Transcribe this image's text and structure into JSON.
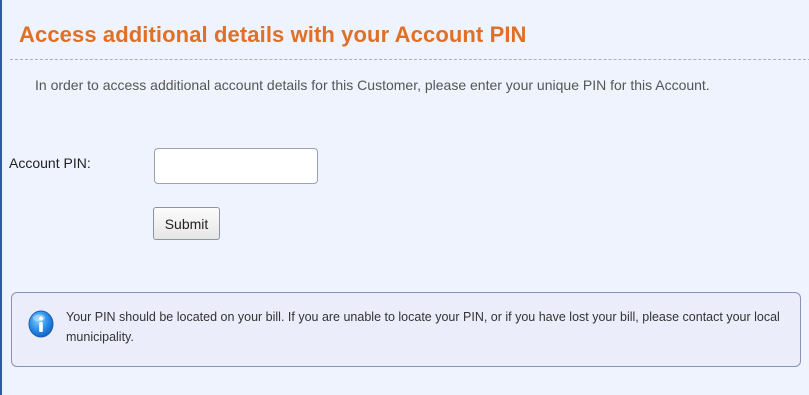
{
  "header": {
    "title": "Access additional details with your Account PIN"
  },
  "intro": {
    "text": "In order to access additional account details for this Customer, please enter your unique PIN for this Account."
  },
  "form": {
    "pin_label": "Account PIN:",
    "pin_value": "",
    "submit_label": "Submit"
  },
  "info": {
    "icon": "info-icon",
    "text": "Your PIN should be located on your bill. If you are unable to locate your PIN, or if you have lost your bill, please contact your local municipality."
  },
  "colors": {
    "title": "#e07026",
    "background": "#eef3fd",
    "left_border": "#2c5aa8",
    "info_background": "#ecedfb",
    "info_border": "#8a92b6"
  }
}
